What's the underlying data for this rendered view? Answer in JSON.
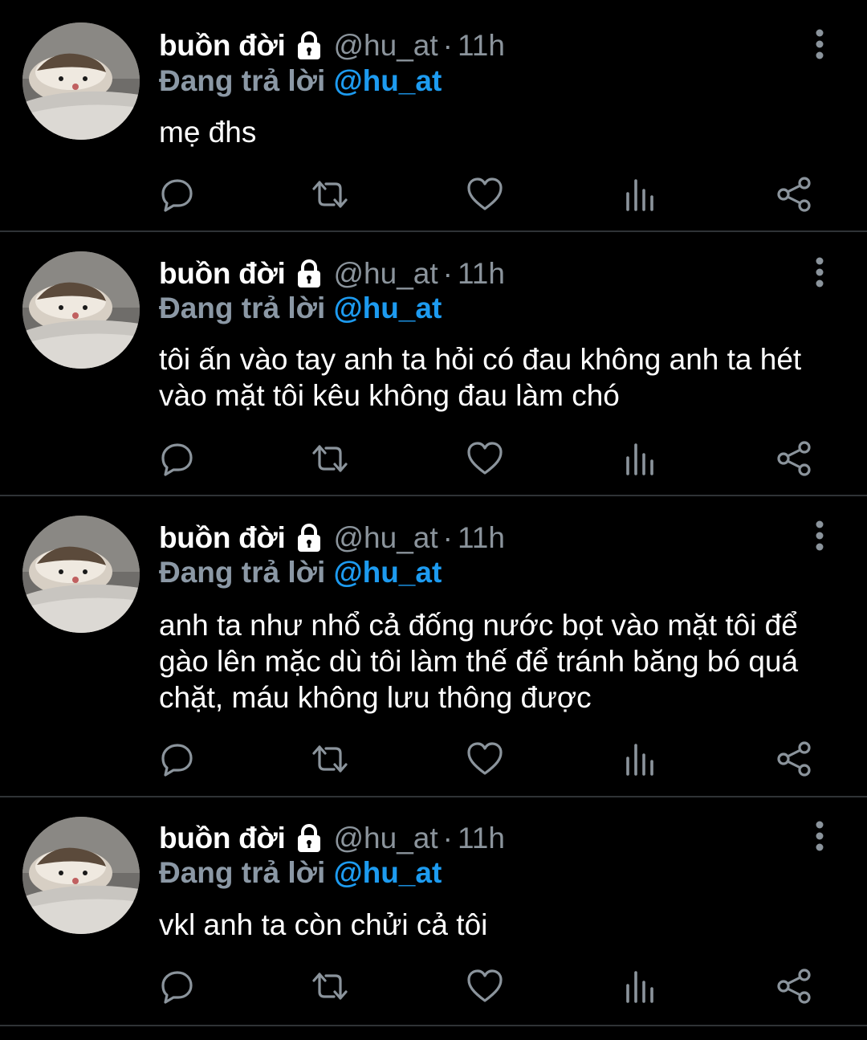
{
  "colors": {
    "background": "#000000",
    "text": "#ffffff",
    "muted": "#8b949c",
    "reply_prefix": "#8b98a5",
    "link": "#1d9bf0",
    "divider": "#2f3336"
  },
  "tweets": [
    {
      "name": "buồn đời",
      "handle": "@hu_at",
      "separator": "·",
      "time": "11h",
      "reply_prefix": "Đang trả lời",
      "reply_handle": "@hu_at",
      "text": "mẹ đhs"
    },
    {
      "name": "buồn đời",
      "handle": "@hu_at",
      "separator": "·",
      "time": "11h",
      "reply_prefix": "Đang trả lời",
      "reply_handle": "@hu_at",
      "text": "tôi ấn vào tay anh ta hỏi có đau không anh ta hét vào mặt tôi kêu không đau làm chó"
    },
    {
      "name": "buồn đời",
      "handle": "@hu_at",
      "separator": "·",
      "time": "11h",
      "reply_prefix": "Đang trả lời",
      "reply_handle": "@hu_at",
      "text": "anh ta như nhổ cả đống nước bọt vào mặt tôi để gào lên mặc dù tôi làm thế để tránh băng bó quá chặt, máu không lưu thông được"
    },
    {
      "name": "buồn đời",
      "handle": "@hu_at",
      "separator": "·",
      "time": "11h",
      "reply_prefix": "Đang trả lời",
      "reply_handle": "@hu_at",
      "text": "vkl anh ta còn chửi cả tôi"
    }
  ],
  "icons": {
    "avatar": "hedgehog-avatar",
    "lock": "lock-icon",
    "more": "more-vertical-icon",
    "reply": "reply-icon",
    "retweet": "retweet-icon",
    "like": "heart-icon",
    "views": "analytics-icon",
    "share": "share-icon"
  }
}
